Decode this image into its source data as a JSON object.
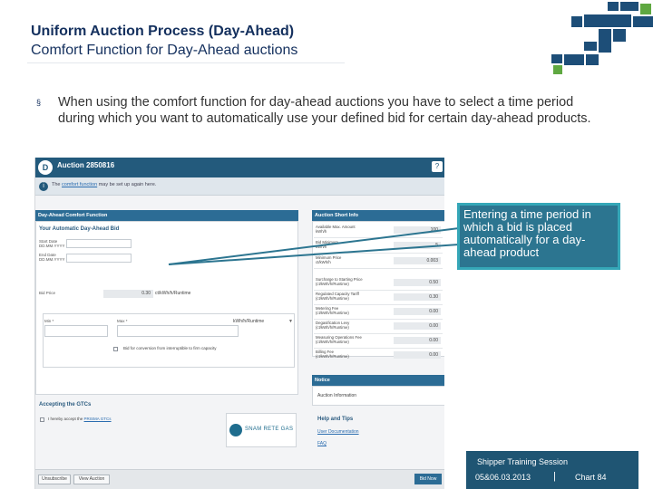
{
  "slide": {
    "title": "Uniform Auction Process (Day-Ahead)",
    "subtitle": "Comfort Function for Day-Ahead auctions",
    "bullet_marker": "§",
    "bullet_text": "When using the comfort function for day-ahead auctions you have to select a time period during which you want to automatically use your defined bid for certain day-ahead products.",
    "callout_text": "Entering a time period in which a bid is placed automatically for a day-ahead product",
    "footer": {
      "session": "Shipper Training Session",
      "date": "05&06.03.2013",
      "separator": "|",
      "chart": "Chart 84"
    }
  },
  "app": {
    "logo_letter": "D",
    "title": "Auction 2850816",
    "help_icon": "?",
    "info_icon": "i",
    "info_text_pre": "The",
    "info_link": "comfort function",
    "info_text_post": "may be set up again here.",
    "comfort_panel_title": "Day-Ahead Comfort Function",
    "comfort_subtitle": "Your Automatic Day-Ahead Bid",
    "start_date_label": "Start Date\nDD.MM.YYYY",
    "end_date_label": "End Date\nDD.MM.YYYY",
    "bid_price_label": "Bid Price",
    "bid_price_value": "0.30",
    "bid_price_unit": "ct/kWh/h/Runtime",
    "min_label": "Min *",
    "max_label": "Max *",
    "unit_option": "kWh/h/Runtime",
    "conversion_label": "Bid for conversion from interruptible to firm capacity",
    "gtc_title": "Accepting the GTCs",
    "gtc_text": "I hereby accept the",
    "gtc_link": "PRISMA GTCs",
    "partner_name": "SNAM RETE GAS",
    "buttons": {
      "unsubscribe": "Unsubscribe",
      "view_auction": "View Auction",
      "bid_now": "Bid Now"
    },
    "auction_short_info": {
      "title": "Auction Short Info",
      "rows": [
        {
          "label": "Available Max. Amount\nkWh/h",
          "value": "100"
        },
        {
          "label": "Bid Minimum\nkWh/h",
          "value": "5"
        },
        {
          "label": "Minimum Price\nct/kWh/h",
          "value": "0.003"
        },
        {
          "label": "Surcharge to Starting Price\n(ct/kWh/h/Runtime)",
          "value": "0.50"
        },
        {
          "label": "Regulated Capacity Tariff\n(ct/kWh/h/Runtime)",
          "value": "0.30"
        },
        {
          "label": "Metering Fee\n(ct/kWh/h/Runtime)",
          "value": "0.00"
        },
        {
          "label": "Degasification Levy\n(ct/kWh/h/Runtime)",
          "value": "0.00"
        },
        {
          "label": "Measuring Operations Fee\n(ct/kWh/h/Runtime)",
          "value": "0.00"
        },
        {
          "label": "Billing Fee\n(ct/kWh/h/Runtime)",
          "value": "0.00"
        }
      ]
    },
    "notice": {
      "title": "Notice",
      "text": "Auction Information"
    },
    "help": {
      "title": "Help and Tips",
      "links": [
        "User Documentation",
        "FAQ"
      ]
    }
  },
  "colors": {
    "slide_title": "#14305e",
    "app_header": "#235a7c",
    "panel_header": "#2c6c95",
    "callout_fill": "#2c7590",
    "callout_border": "#35a7b8",
    "footer_box": "#1f5573",
    "logo_blue": "#1d4e78",
    "logo_green": "#5fa841"
  }
}
